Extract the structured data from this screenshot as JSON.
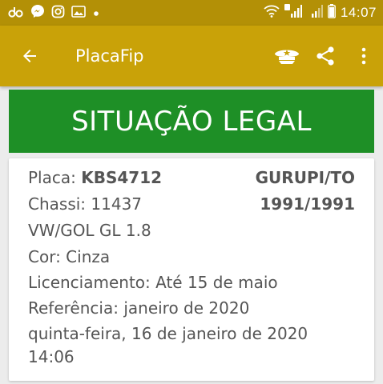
{
  "status_bar": {
    "time": "14:07"
  },
  "app_bar": {
    "title": "PlacaFip"
  },
  "banner": {
    "text": "SITUAÇÃO LEGAL"
  },
  "vehicle": {
    "placa_label": "Placa:",
    "placa_value": "KBS4712",
    "location": "GURUPI/TO",
    "chassi_label": "Chassi:",
    "chassi_value": "11437",
    "year": "1991/1991",
    "model": "VW/GOL GL 1.8",
    "cor_label": "Cor:",
    "cor_value": "Cinza",
    "licenciamento_label": "Licenciamento:",
    "licenciamento_value": "Até 15 de maio",
    "referencia_label": "Referência:",
    "referencia_value": "janeiro de 2020",
    "date": "quinta-feira, 16 de janeiro de 2020",
    "time": "14:06"
  },
  "colors": {
    "status_bar": "#b39006",
    "app_bar": "#c9a208",
    "banner": "#1e8f26"
  }
}
